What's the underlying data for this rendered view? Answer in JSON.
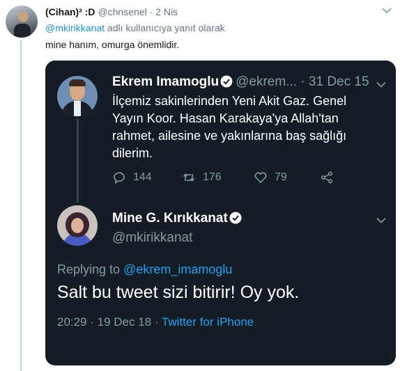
{
  "outer_tweet": {
    "name": "(Cihan)² :D",
    "handle": "@chnsenel",
    "separator": "·",
    "time": "2 Nis",
    "reply_mention": "@mkirikkanat",
    "reply_suffix": "adlı kullanıcıya yanıt olarak",
    "text": "mine hanım, omurga önemlidir."
  },
  "quoted_tweet": {
    "name": "Ekrem Imamoglu",
    "handle": "@ekrem...",
    "separator": "·",
    "time": "31 Dec 15",
    "text_lines": [
      "İlçemiz sakinlerinden Yeni Akit Gaz. Genel",
      "Yayın Koor. Hasan Karakaya'ya Allah'tan",
      "rahmet, ailesine ve yakınlarına baş sağlığı",
      "dilerim."
    ],
    "reply_count": "144",
    "retweet_count": "176",
    "like_count": "79"
  },
  "reply_tweet": {
    "name": "Mine G. Kırıkkanat",
    "handle": "@mkirikkanat",
    "replying_prefix": "Replying to",
    "replying_mention": "@ekrem_imamoglu",
    "text": "Salt bu tweet sizi bitirir! Oy yok.",
    "time": "20:29 · 19 Dec 18 ·",
    "source": "Twitter for iPhone"
  },
  "colors": {
    "accent": "#1da1f2",
    "dark_background": "#141d26",
    "muted": "#8899a6",
    "thread_line": "#a8dcf2"
  }
}
